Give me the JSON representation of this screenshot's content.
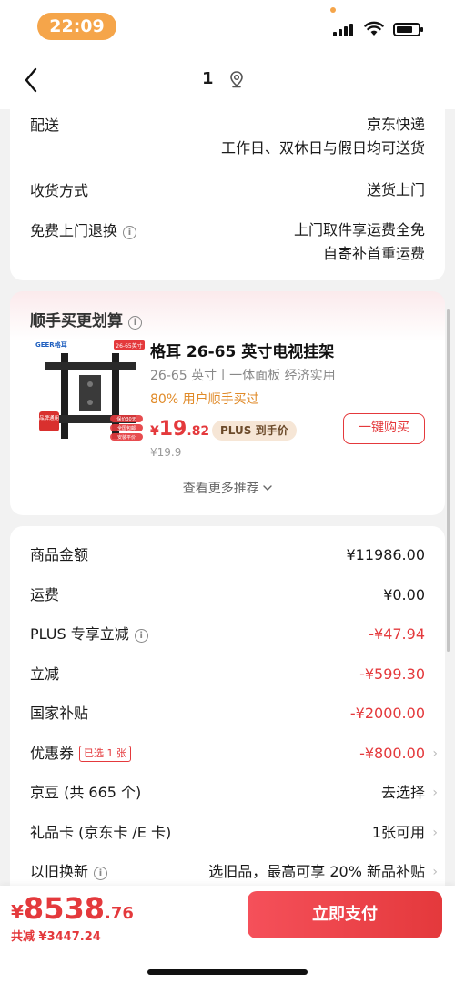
{
  "status_bar": {
    "time": "22:09"
  },
  "nav": {
    "title": "1",
    "back_icon": "chevron-left-icon",
    "location_icon": "location-pin-icon"
  },
  "delivery": {
    "rows": [
      {
        "label": "配送",
        "value_lines": [
          "京东快递",
          "工作日、双休日与假日均可送货"
        ]
      },
      {
        "label": "收货方式",
        "value_lines": [
          "送货上门"
        ]
      },
      {
        "label": "免费上门退换",
        "has_info": true,
        "value_lines": [
          "上门取件享运费全免",
          "自寄补首重运费"
        ]
      }
    ]
  },
  "recommend": {
    "title": "顺手买更划算",
    "product": {
      "image_brand": "GEER格耳",
      "image_tag": "26-65英寸",
      "image_badge": "品牌通用",
      "image_features": [
        "保价30天",
        "全国包邮",
        "安装平价"
      ],
      "name": "格耳 26-65 英寸电视挂架",
      "desc": "26-65 英寸丨一体面板 经济实用",
      "buyers": "80% 用户顺手买过",
      "price_currency": "¥",
      "price_int": "19",
      "price_dec": ".82",
      "plus_tag": "PLUS 到手价",
      "old_price": "¥19.9",
      "buy_label": "一键购买"
    },
    "more_label": "查看更多推荐"
  },
  "summary": {
    "rows": [
      {
        "label": "商品金额",
        "value": "¥11986.00",
        "red": false
      },
      {
        "label": "运费",
        "value": "¥0.00",
        "red": false
      },
      {
        "label": "PLUS 专享立减",
        "value": "-¥47.94",
        "red": true,
        "has_info": true
      },
      {
        "label": "立减",
        "value": "-¥599.30",
        "red": true
      },
      {
        "label": "国家补贴",
        "value": "-¥2000.00",
        "red": true
      },
      {
        "label": "优惠券",
        "value": "-¥800.00",
        "red": true,
        "tag": "已选 1 张",
        "arrow": true
      },
      {
        "label": "京豆 (共 665 个)",
        "value": "去选择",
        "red": false,
        "arrow": true
      },
      {
        "label": "礼品卡 (京东卡 /E 卡)",
        "value": "1张可用",
        "red": false,
        "arrow": true
      },
      {
        "label": "以旧换新",
        "value": "选旧品，最高可享 20% 新品补贴",
        "red": false,
        "has_info": true,
        "arrow": true
      }
    ]
  },
  "footer": {
    "currency": "¥",
    "total_int": "8538",
    "total_dec": ".76",
    "saved": "共减 ¥3447.24",
    "pay_label": "立即支付"
  },
  "colors": {
    "accent_red": "#e4393c",
    "status_pill": "#f5a54a",
    "buyers_orange": "#e08a28"
  }
}
